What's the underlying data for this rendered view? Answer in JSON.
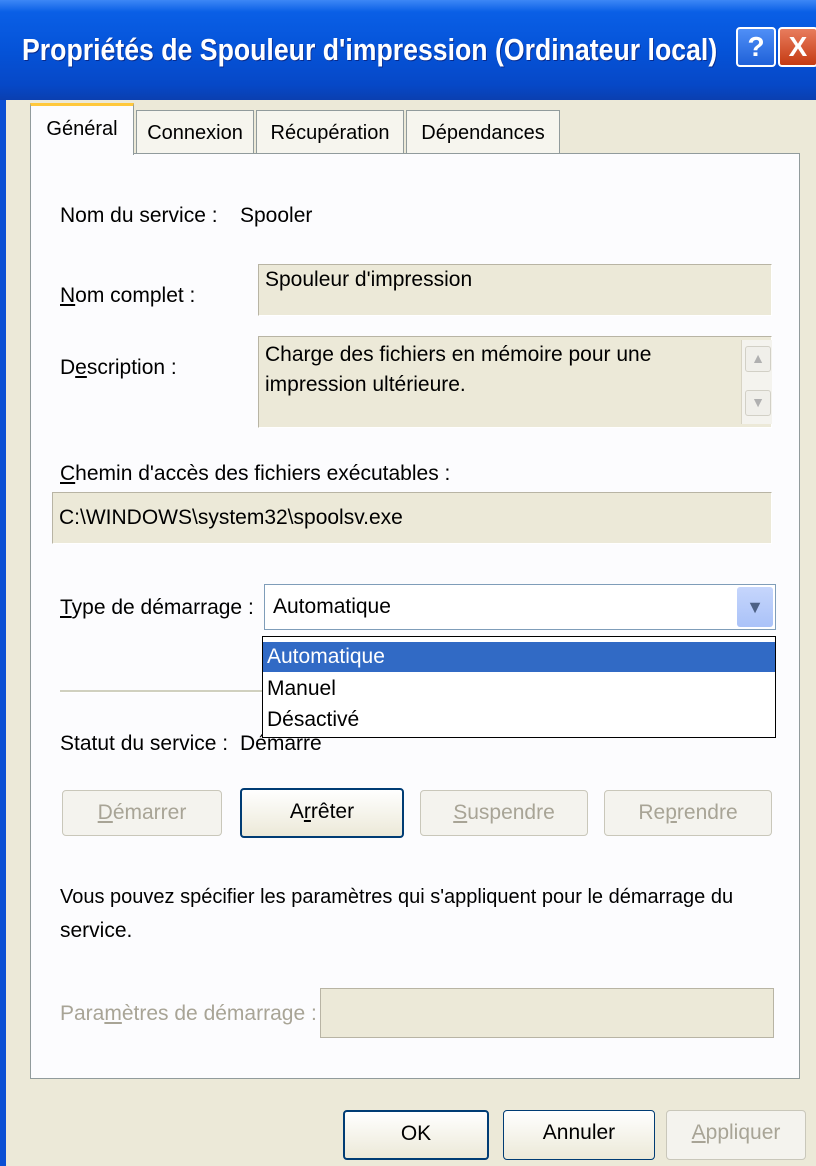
{
  "window": {
    "title": "Propriétés de Spouleur d'impression (Ordinateur local)",
    "help_glyph": "?",
    "close_glyph": "X"
  },
  "tabs": [
    {
      "label": "Général",
      "selected": true
    },
    {
      "label": "Connexion",
      "selected": false
    },
    {
      "label": "Récupération",
      "selected": false
    },
    {
      "label": "Dépendances",
      "selected": false
    }
  ],
  "general": {
    "service_name_label": "Nom du service :",
    "service_name_value": "Spooler",
    "display_name_label": "Nom complet :",
    "display_name_value": "Spouleur d'impression",
    "description_label": "Description :",
    "description_line1": "Charge des fichiers en mémoire pour une",
    "description_line2": "impression ultérieure.",
    "path_label": "Chemin d'accès des fichiers exécutables :",
    "path_value": "C:\\WINDOWS\\system32\\spoolsv.exe",
    "startup_type_label": "Type de démarrage :",
    "startup_type_value": "Automatique",
    "startup_options": [
      "Automatique",
      "Manuel",
      "Désactivé"
    ],
    "status_label": "Statut du service :",
    "status_value": "Démarré",
    "buttons": {
      "start": "Démarrer",
      "stop": "Arrêter",
      "pause": "Suspendre",
      "resume": "Reprendre"
    },
    "params_hint_line1": "Vous pouvez spécifier les paramètres qui s'appliquent pour le démarrage du",
    "params_hint_line2": "service.",
    "params_label": "Paramètres de démarrage :",
    "params_value": ""
  },
  "footer": {
    "ok": "OK",
    "cancel": "Annuler",
    "apply": "Appliquer"
  },
  "colors": {
    "titlebar": "#0553d8",
    "dialog_bg": "#ece9d8",
    "selection": "#316ac5",
    "close_button": "#c53b13",
    "tab_highlight": "#ffc83c"
  },
  "icons": {
    "combo_arrow": "chevron-down-icon",
    "scroll_up": "scroll-up-icon",
    "scroll_down": "scroll-down-icon"
  }
}
